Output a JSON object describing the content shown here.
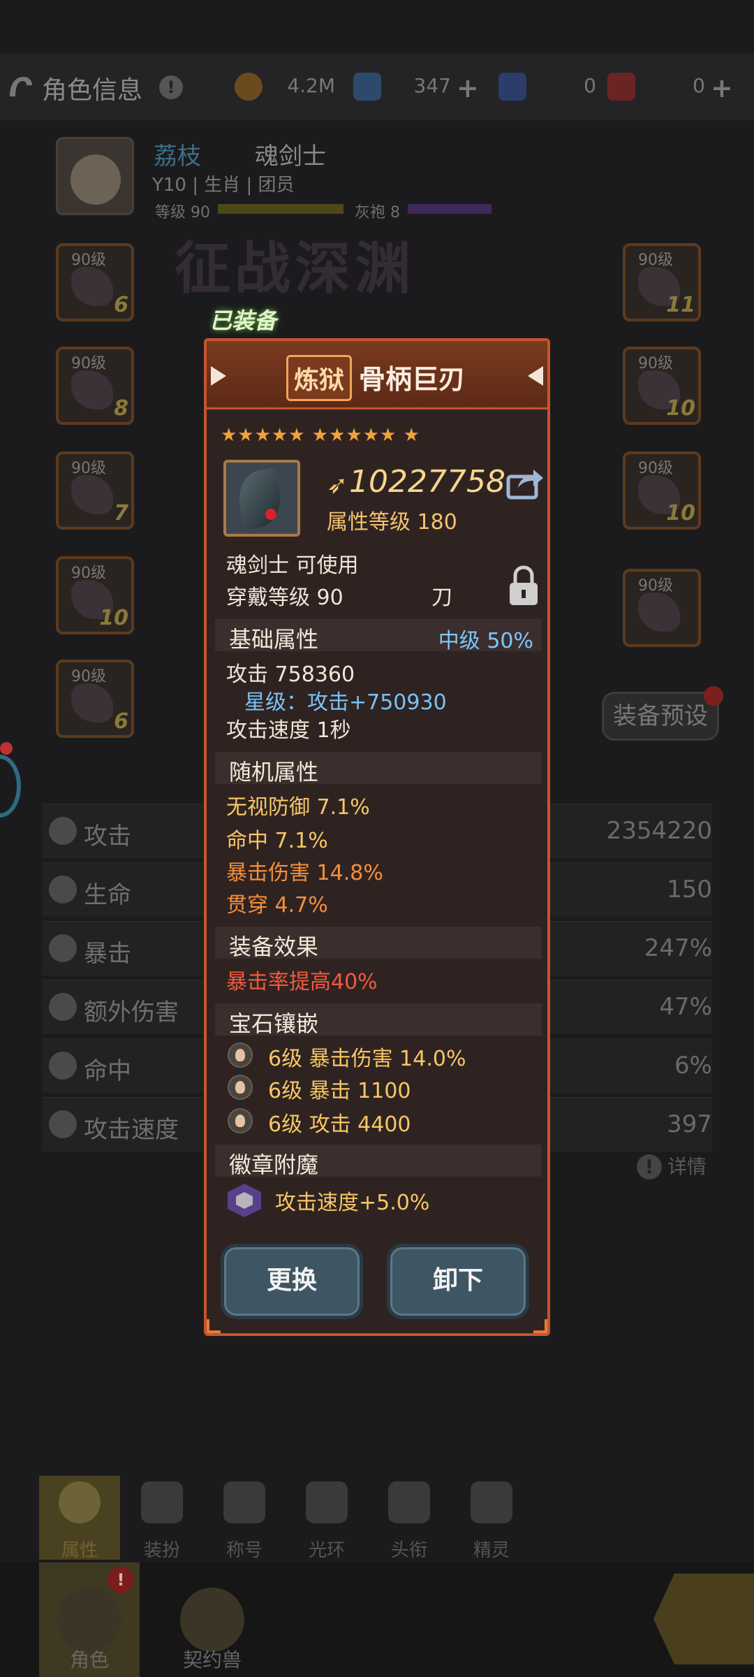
{
  "header": {
    "title": "角色信息",
    "resources": [
      {
        "icon": "gold-coin-icon",
        "value": "4.2M"
      },
      {
        "icon": "blue-crystal-icon",
        "value": "347"
      },
      {
        "icon": "blue-ticket-icon",
        "value": "0"
      },
      {
        "icon": "red-ticket-icon",
        "value": "0"
      }
    ]
  },
  "profile": {
    "name": "荔枝",
    "class": "魂剑士",
    "line2": "Y10 | 生肖 | 团员",
    "level_label": "等级 90",
    "robe_label": "灰袍 8"
  },
  "banner_text": "征战深渊",
  "slots": {
    "left": [
      {
        "level": "90级",
        "count": "6"
      },
      {
        "level": "90级",
        "count": "8"
      },
      {
        "level": "90级",
        "count": "7"
      },
      {
        "level": "90级",
        "count": "10"
      },
      {
        "level": "90级",
        "count": "6"
      }
    ],
    "right": [
      {
        "level": "90级",
        "count": "11"
      },
      {
        "level": "90级",
        "count": "10"
      },
      {
        "level": "90级",
        "count": "10"
      },
      {
        "level": "90级",
        "count": ""
      }
    ]
  },
  "preset_label": "装备预设",
  "stats": [
    {
      "icon": "attack-icon",
      "name": "攻击",
      "value": "2354220"
    },
    {
      "icon": "heart-icon",
      "name": "生命",
      "value": "150"
    },
    {
      "icon": "crit-icon",
      "name": "暴击",
      "value": "247%"
    },
    {
      "icon": "extra-damage-icon",
      "name": "额外伤害",
      "value": "47%"
    },
    {
      "icon": "target-icon",
      "name": "命中",
      "value": "6%"
    },
    {
      "icon": "attack-speed-icon",
      "name": "攻击速度",
      "value": "397"
    }
  ],
  "detail_label": "详情",
  "subnav": [
    "属性",
    "装扮",
    "称号",
    "光环",
    "头衔",
    "精灵"
  ],
  "bottomnav": [
    "角色",
    "契约兽"
  ],
  "item": {
    "equipped_badge": "已装备",
    "grade": "炼狱",
    "name": "骨柄巨刃",
    "stars": "★★★★★ ★★★★★ ★",
    "power": "10227758",
    "attr_level": "属性等级 180",
    "usable": "魂剑士 可使用",
    "wear_level": "穿戴等级 90",
    "type": "刀",
    "base_section": {
      "title": "基础属性",
      "tier": "中级 50%"
    },
    "base_attack": "攻击  758360",
    "star_bonus": "星级：攻击+750930",
    "attack_speed": "攻击速度  1秒",
    "random_section": "随机属性",
    "random_attrs": [
      {
        "text": "无视防御    7.1%",
        "color": "#f7c766"
      },
      {
        "text": "命中    7.1%",
        "color": "#f7c766"
      },
      {
        "text": "暴击伤害    14.8%",
        "color": "#f58f3a"
      },
      {
        "text": "贯穿    4.7%",
        "color": "#f58f3a"
      }
    ],
    "effect_section": "装备效果",
    "effect": "暴击率提高40%",
    "gem_section": "宝石镶嵌",
    "gems": [
      "6级    暴击伤害 14.0%",
      "6级    暴击 1100",
      "6级    攻击 4400"
    ],
    "emblem_section": "徽章附魔",
    "emblem": "攻击速度+5.0%",
    "replace_label": "更换",
    "unequip_label": "卸下"
  }
}
